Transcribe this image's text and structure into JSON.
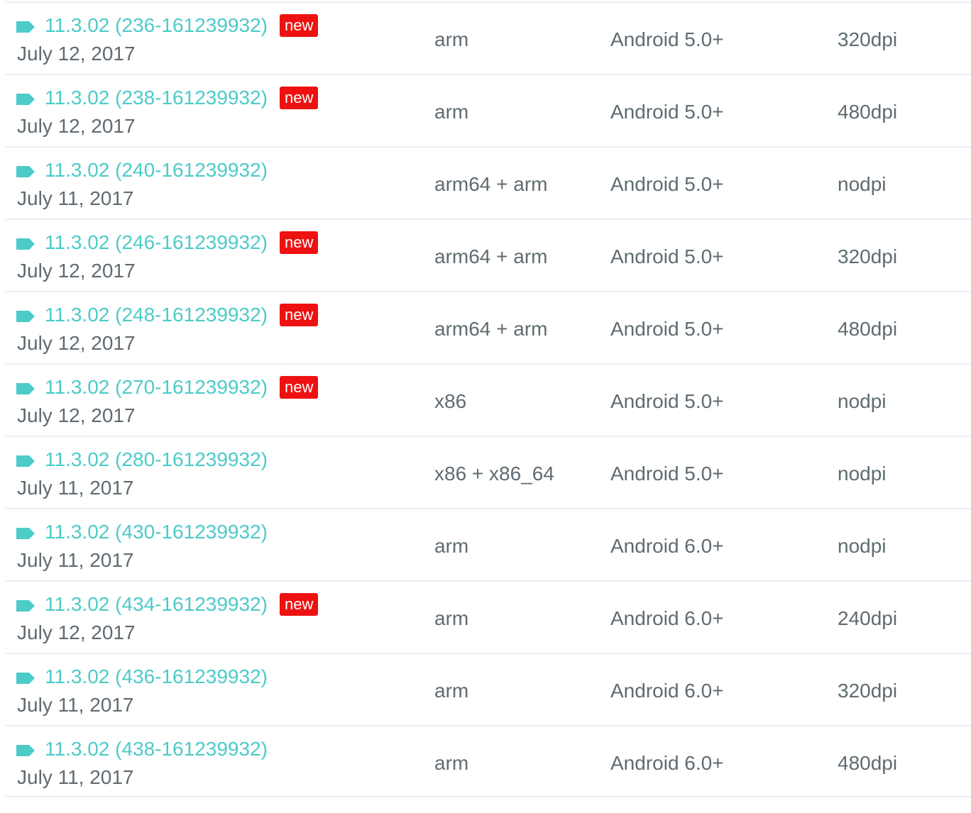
{
  "colors": {
    "accent": "#4ccbc9",
    "text": "#5f6b71",
    "badge_bg": "#ee1111",
    "divider": "#eceff1"
  },
  "icon": "tag-icon",
  "rows": [
    {
      "version": "11.3.02 (236-161239932)",
      "badge": "new",
      "date": "July 12, 2017",
      "arch": "arm",
      "min_android": "Android 5.0+",
      "dpi": "320dpi"
    },
    {
      "version": "11.3.02 (238-161239932)",
      "badge": "new",
      "date": "July 12, 2017",
      "arch": "arm",
      "min_android": "Android 5.0+",
      "dpi": "480dpi"
    },
    {
      "version": "11.3.02 (240-161239932)",
      "badge": "",
      "date": "July 11, 2017",
      "arch": "arm64 + arm",
      "min_android": "Android 5.0+",
      "dpi": "nodpi"
    },
    {
      "version": "11.3.02 (246-161239932)",
      "badge": "new",
      "date": "July 12, 2017",
      "arch": "arm64 + arm",
      "min_android": "Android 5.0+",
      "dpi": "320dpi"
    },
    {
      "version": "11.3.02 (248-161239932)",
      "badge": "new",
      "date": "July 12, 2017",
      "arch": "arm64 + arm",
      "min_android": "Android 5.0+",
      "dpi": "480dpi"
    },
    {
      "version": "11.3.02 (270-161239932)",
      "badge": "new",
      "date": "July 12, 2017",
      "arch": "x86",
      "min_android": "Android 5.0+",
      "dpi": "nodpi"
    },
    {
      "version": "11.3.02 (280-161239932)",
      "badge": "",
      "date": "July 11, 2017",
      "arch": "x86 + x86_64",
      "min_android": "Android 5.0+",
      "dpi": "nodpi"
    },
    {
      "version": "11.3.02 (430-161239932)",
      "badge": "",
      "date": "July 11, 2017",
      "arch": "arm",
      "min_android": "Android 6.0+",
      "dpi": "nodpi"
    },
    {
      "version": "11.3.02 (434-161239932)",
      "badge": "new",
      "date": "July 12, 2017",
      "arch": "arm",
      "min_android": "Android 6.0+",
      "dpi": "240dpi"
    },
    {
      "version": "11.3.02 (436-161239932)",
      "badge": "",
      "date": "July 11, 2017",
      "arch": "arm",
      "min_android": "Android 6.0+",
      "dpi": "320dpi"
    },
    {
      "version": "11.3.02 (438-161239932)",
      "badge": "",
      "date": "July 11, 2017",
      "arch": "arm",
      "min_android": "Android 6.0+",
      "dpi": "480dpi"
    }
  ]
}
